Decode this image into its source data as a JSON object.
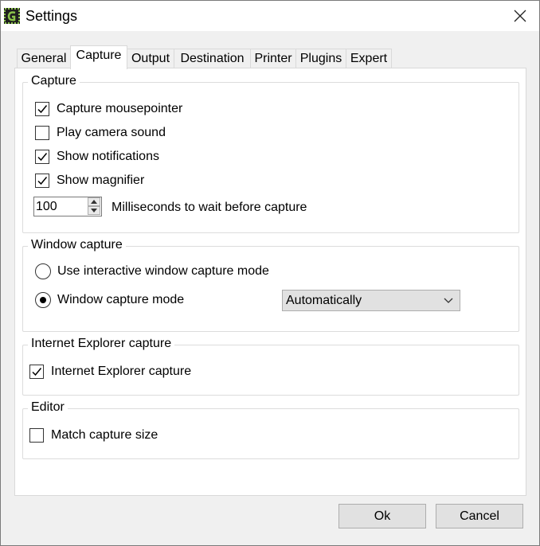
{
  "window": {
    "title": "Settings",
    "app_icon": "greenshot-icon",
    "close_icon": "close-icon"
  },
  "tabs": [
    {
      "label": "General",
      "active": false
    },
    {
      "label": "Capture",
      "active": true
    },
    {
      "label": "Output",
      "active": false
    },
    {
      "label": "Destination",
      "active": false
    },
    {
      "label": "Printer",
      "active": false
    },
    {
      "label": "Plugins",
      "active": false
    },
    {
      "label": "Expert",
      "active": false
    }
  ],
  "capture_group": {
    "title": "Capture",
    "options": [
      {
        "label": "Capture mousepointer",
        "checked": true
      },
      {
        "label": "Play camera sound",
        "checked": false
      },
      {
        "label": "Show notifications",
        "checked": true
      },
      {
        "label": "Show magnifier",
        "checked": true
      }
    ],
    "wait_value": "100",
    "wait_label": "Milliseconds to wait before capture"
  },
  "window_capture_group": {
    "title": "Window capture",
    "interactive_label": "Use interactive window capture mode",
    "interactive_selected": false,
    "mode_label": "Window capture mode",
    "mode_selected": true,
    "mode_value": "Automatically"
  },
  "ie_group": {
    "title": "Internet Explorer capture",
    "option_label": "Internet Explorer capture",
    "checked": true
  },
  "editor_group": {
    "title": "Editor",
    "option_label": "Match capture size",
    "checked": false
  },
  "buttons": {
    "ok": "Ok",
    "cancel": "Cancel"
  }
}
